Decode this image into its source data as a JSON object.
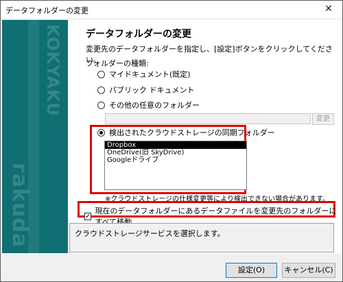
{
  "window": {
    "title": "データフォルダーの変更",
    "close_glyph": "✕"
  },
  "sidebar": {
    "text_top": "KOKYAKU",
    "text_bottom": "rakuda",
    "color": "#0f6f73"
  },
  "main": {
    "heading": "データフォルダーの変更",
    "description": "変更先のデータフォルダーを指定し、[設定]ボタンをクリックしてください。",
    "section_label": "フォルダーの種類:",
    "radios": [
      {
        "label": "マイドキュメント(既定)",
        "checked": false
      },
      {
        "label": "パブリック ドキュメント",
        "checked": false
      },
      {
        "label": "その他の任意のフォルダー",
        "checked": false
      },
      {
        "label": "検出されたクラウドストレージの同期フォルダー",
        "checked": true
      }
    ],
    "path_value": "",
    "change_button": "変更",
    "cloud_list": [
      {
        "label": "Dropbox",
        "selected": true
      },
      {
        "label": "OneDrive(旧 SkyDrive)",
        "selected": false
      },
      {
        "label": "Googleドライブ",
        "selected": false
      }
    ],
    "note": "※クラウドストレージの仕様変更等により検出できない場合があります。",
    "move_checkbox": {
      "label": "現在のデータフォルダーにあるデータファイルを変更先のフォルダーにすべて移動",
      "checked": true
    },
    "status_text": "クラウドストレージサービスを選択します。"
  },
  "footer": {
    "ok_label": "設定(O)",
    "cancel_label": "キャンセル(C)"
  },
  "colors": {
    "highlight_border": "#e00000",
    "selected_bg": "#000000"
  }
}
